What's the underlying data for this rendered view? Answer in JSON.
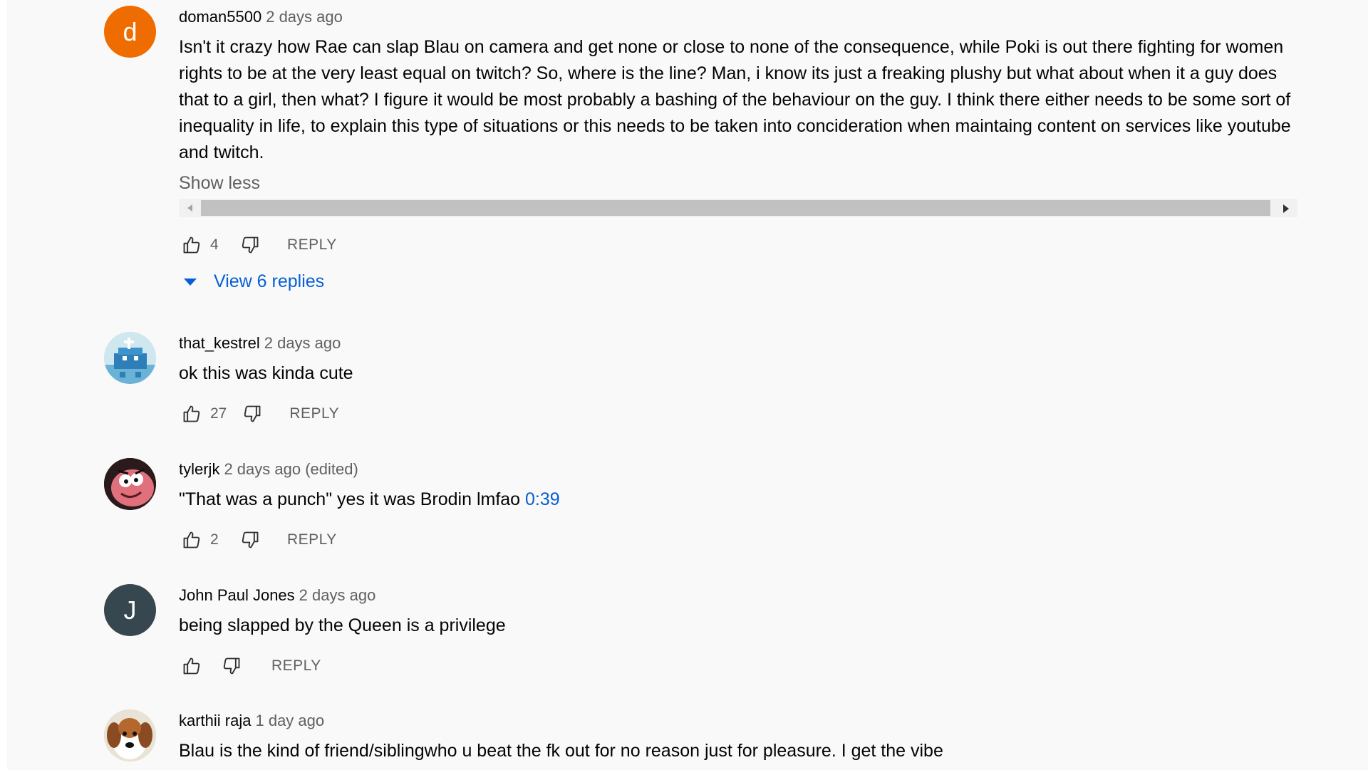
{
  "comments": [
    {
      "author": "doman5500",
      "time": "2 days ago",
      "avatar_letter": "d",
      "avatar_color": "#ef6c00",
      "text": "Isn't it crazy how Rae can slap Blau on camera and get none or close to none of the consequence, while Poki is out there fighting for women rights to be at the very least equal on twitch? So, where is the line? Man, i know its just a freaking plushy but what about when it a guy does that to a girl, then what? I figure it would be most probably a bashing of the behaviour on the guy. I think there either needs to be some sort of inequality in life, to explain this type of situations or this needs to be taken into concideration when maintaing content on services like youtube and twitch.",
      "show_less": "Show less",
      "likes": "4",
      "reply": "REPLY",
      "view_replies": "View 6 replies"
    },
    {
      "author": "that_kestrel",
      "time": "2 days ago",
      "avatar_icon": "pixel-art-icon",
      "text": "ok this was kinda cute",
      "likes": "27",
      "reply": "REPLY"
    },
    {
      "author": "tylerjk",
      "time": "2 days ago (edited)",
      "avatar_icon": "cartoon-character-icon",
      "text": "\"That was a punch\" yes it was Brodin lmfao ",
      "timestamp_link": "0:39",
      "likes": "2",
      "reply": "REPLY"
    },
    {
      "author": "John Paul Jones",
      "time": "2 days ago",
      "avatar_letter": "J",
      "avatar_color": "#37474f",
      "text": "being slapped by the Queen is a privilege",
      "likes": "",
      "reply": "REPLY"
    },
    {
      "author": "karthii raja",
      "time": "1 day ago",
      "avatar_icon": "dog-photo-icon",
      "text": "Blau is the kind of friend/siblingwho u beat the fk out for no reason just for pleasure. I get the vibe"
    }
  ]
}
